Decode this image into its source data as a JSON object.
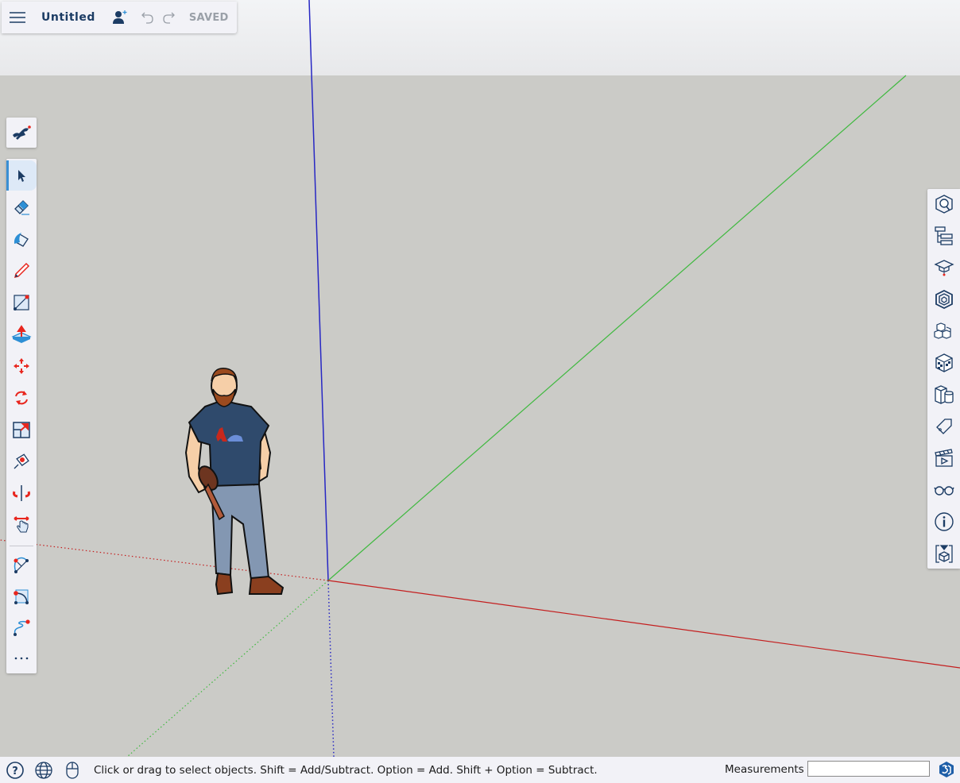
{
  "app": {
    "title": "Untitled",
    "save_status": "SAVED"
  },
  "topbar": {
    "icons": [
      "menu-icon",
      "add-collaborator-icon",
      "undo-icon",
      "redo-icon"
    ]
  },
  "colors": {
    "accent": "#1c3c64",
    "active_tool_bar": "#3a8fd4",
    "tool_red": "#e8261e",
    "tool_blue": "#2d8fd5",
    "axis_red": "#c41e1e",
    "axis_green": "#3fb93f",
    "axis_blue": "#2727c4",
    "ground": "#cbcbc7",
    "sky": "#eceef0"
  },
  "left_toolbar": {
    "logo": "sketchup-dog-logo-icon",
    "tools": [
      {
        "name": "select",
        "icon": "select-arrow-icon",
        "active": true
      },
      {
        "name": "eraser",
        "icon": "eraser-icon",
        "active": false
      },
      {
        "name": "paint-bucket",
        "icon": "paint-bucket-icon",
        "active": false
      },
      {
        "name": "pencil",
        "icon": "pencil-icon",
        "active": false
      },
      {
        "name": "line",
        "icon": "line-tool-icon",
        "active": false
      },
      {
        "name": "push-pull",
        "icon": "push-pull-icon",
        "active": false
      },
      {
        "name": "move",
        "icon": "move-icon",
        "active": false
      },
      {
        "name": "rotate",
        "icon": "rotate-icon",
        "active": false
      },
      {
        "name": "scale",
        "icon": "scale-icon",
        "active": false
      },
      {
        "name": "tape-measure",
        "icon": "tape-measure-icon",
        "active": false
      },
      {
        "name": "orbit",
        "icon": "orbit-icon",
        "active": false
      },
      {
        "name": "pan",
        "icon": "pan-hand-icon",
        "active": false
      },
      {
        "name": "arc",
        "icon": "arc-icon",
        "active": false
      },
      {
        "name": "two-point-arc",
        "icon": "two-point-arc-icon",
        "active": false
      },
      {
        "name": "freehand",
        "icon": "freehand-icon",
        "active": false
      },
      {
        "name": "more",
        "icon": "more-dots-icon",
        "active": false
      }
    ]
  },
  "right_toolbar": {
    "panels": [
      {
        "name": "entity-info-search",
        "icon": "search-model-icon"
      },
      {
        "name": "outliner",
        "icon": "outliner-icon"
      },
      {
        "name": "instructor",
        "icon": "graduation-cap-icon"
      },
      {
        "name": "components",
        "icon": "components-icon"
      },
      {
        "name": "3d-warehouse",
        "icon": "cubes-icon"
      },
      {
        "name": "materials",
        "icon": "materials-cube-icon"
      },
      {
        "name": "solid-tools",
        "icon": "solid-tools-icon"
      },
      {
        "name": "tags",
        "icon": "tag-icon"
      },
      {
        "name": "scenes",
        "icon": "clapperboard-icon"
      },
      {
        "name": "display",
        "icon": "glasses-icon"
      },
      {
        "name": "model-info",
        "icon": "info-icon"
      },
      {
        "name": "export",
        "icon": "export-box-icon"
      }
    ]
  },
  "statusbar": {
    "icons": [
      "help-icon",
      "globe-icon",
      "mouse-icon"
    ],
    "hint": "Click or drag to select objects. Shift = Add/Subtract. Option = Add. Shift + Option = Subtract.",
    "measurements_label": "Measurements",
    "measurements_value": ""
  }
}
